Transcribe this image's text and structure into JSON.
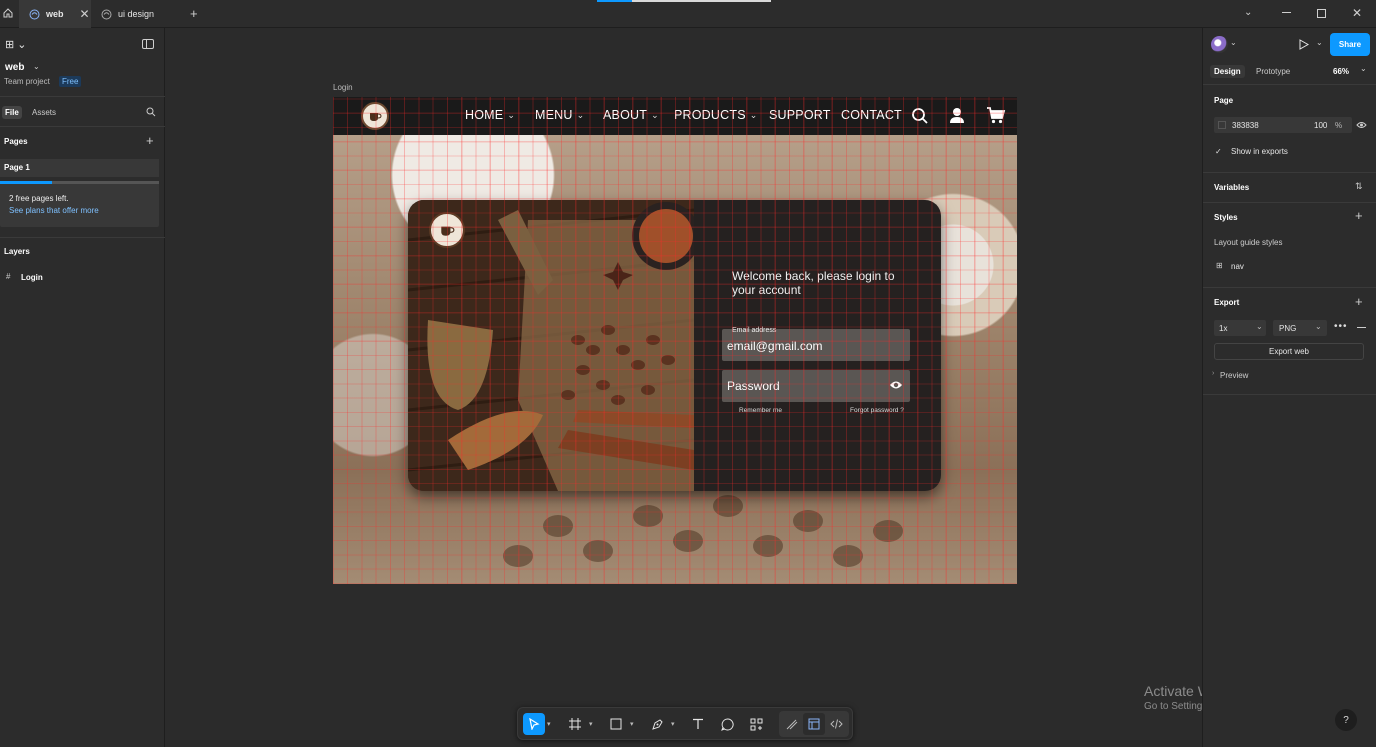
{
  "tabs": [
    {
      "label": "web",
      "active": true
    },
    {
      "label": "ui design",
      "active": false
    }
  ],
  "left_panel": {
    "project_name": "web",
    "team_label": "Team project",
    "plan_badge": "Free",
    "file_tab": "File",
    "assets_tab": "Assets",
    "pages_heading": "Pages",
    "page_item": "Page 1",
    "notice_line1": "2 free pages left.",
    "notice_link": "See plans that offer more",
    "layers_heading": "Layers",
    "layer_item": "Login"
  },
  "canvas": {
    "frame_label": "Login",
    "nav_items": [
      "HOME",
      "MENU",
      "ABOUT",
      "PRODUCTS",
      "SUPPORT",
      "CONTACT"
    ],
    "welcome_text": "Welcome back, please login to your account",
    "email_label": "Email address",
    "email_value": "email@gmail.com",
    "password_placeholder": "Password",
    "remember_label": "Remember me",
    "forgot_label": "Forgot password ?"
  },
  "right_panel": {
    "share_label": "Share",
    "design_tab": "Design",
    "prototype_tab": "Prototype",
    "zoom": "66%",
    "page_heading": "Page",
    "page_color": "383838",
    "page_opacity": "100",
    "percent_sign": "%",
    "show_exports": "Show in exports",
    "variables_heading": "Variables",
    "styles_heading": "Styles",
    "layout_guide_styles": "Layout guide styles",
    "nav_style": "nav",
    "export_heading": "Export",
    "export_scale": "1x",
    "export_format": "PNG",
    "export_button": "Export web",
    "preview_label": "Preview"
  },
  "watermark": {
    "title": "Activate Windows",
    "subtitle": "Go to Settings to activate Windows."
  },
  "help_label": "?",
  "colors": {
    "accent": "#0d99ff",
    "panel_bg": "#2c2c2c",
    "page_bg": "#383838"
  }
}
